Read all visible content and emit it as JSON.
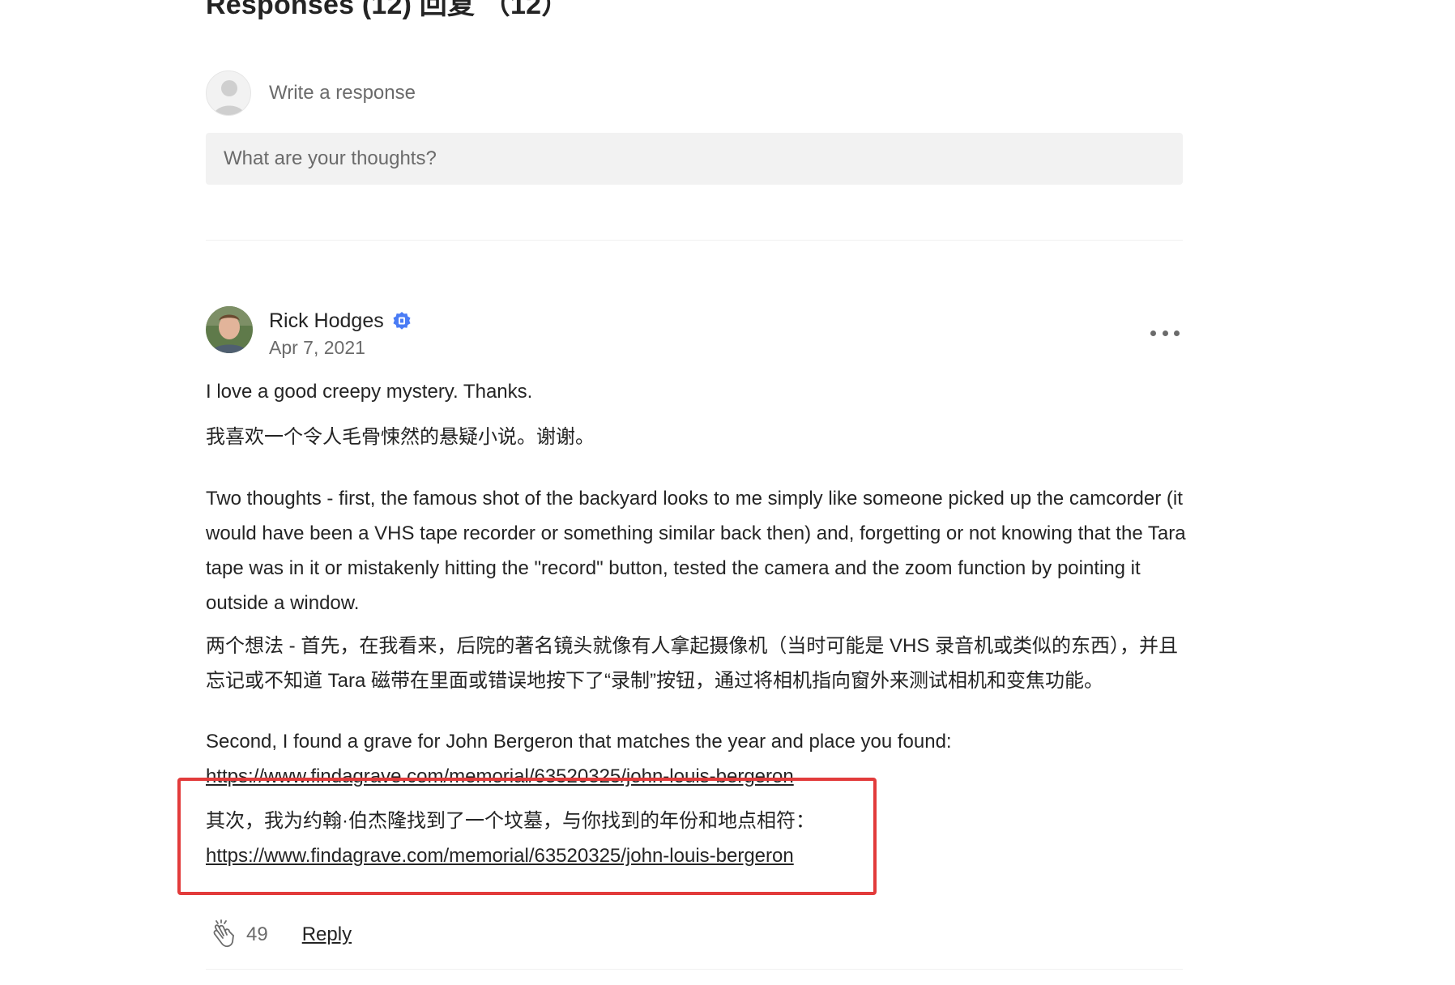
{
  "responses": {
    "heading": "Responses (12) 回复 （12）"
  },
  "composer": {
    "label": "Write a response",
    "placeholder": "What are your thoughts?"
  },
  "comment": {
    "author": "Rick Hodges",
    "date": "Apr 7, 2021",
    "paragraphs": [
      "I love a good creepy mystery. Thanks.",
      "我喜欢一个令人毛骨悚然的悬疑小说。谢谢。",
      "Two thoughts - first, the famous shot of the backyard looks to me simply like someone picked up the camcorder (it would have been a VHS tape recorder or something similar back then) and, forgetting or not knowing that the Tara tape was in it or mistakenly hitting the \"record\" button, tested the camera and the zoom function by pointing it outside a window.",
      "两个想法 - 首先，在我看来，后院的著名镜头就像有人拿起摄像机（当时可能是 VHS 录音机或类似的东西），并且忘记或不知道 Tara 磁带在里面或错误地按下了“录制”按钮，通过将相机指向窗外来测试相机和变焦功能。",
      "Second, I found a grave for John Bergeron that matches the year and place you found:",
      "其次，我为约翰·伯杰隆找到了一个坟墓，与你找到的年份和地点相符："
    ],
    "link": "https://www.findagrave.com/memorial/63520325/john-louis-bergeron",
    "claps": "49",
    "reply_label": "Reply"
  },
  "colors": {
    "text": "#242424",
    "muted": "#6b6b6b",
    "input_bg": "#f2f2f2",
    "verified_blue": "#4a7cf5",
    "annotation_red": "#e23b3b"
  },
  "icons": [
    "chevron-down-icon",
    "default-avatar-icon",
    "verified-badge-icon",
    "more-options-icon",
    "clap-icon"
  ]
}
